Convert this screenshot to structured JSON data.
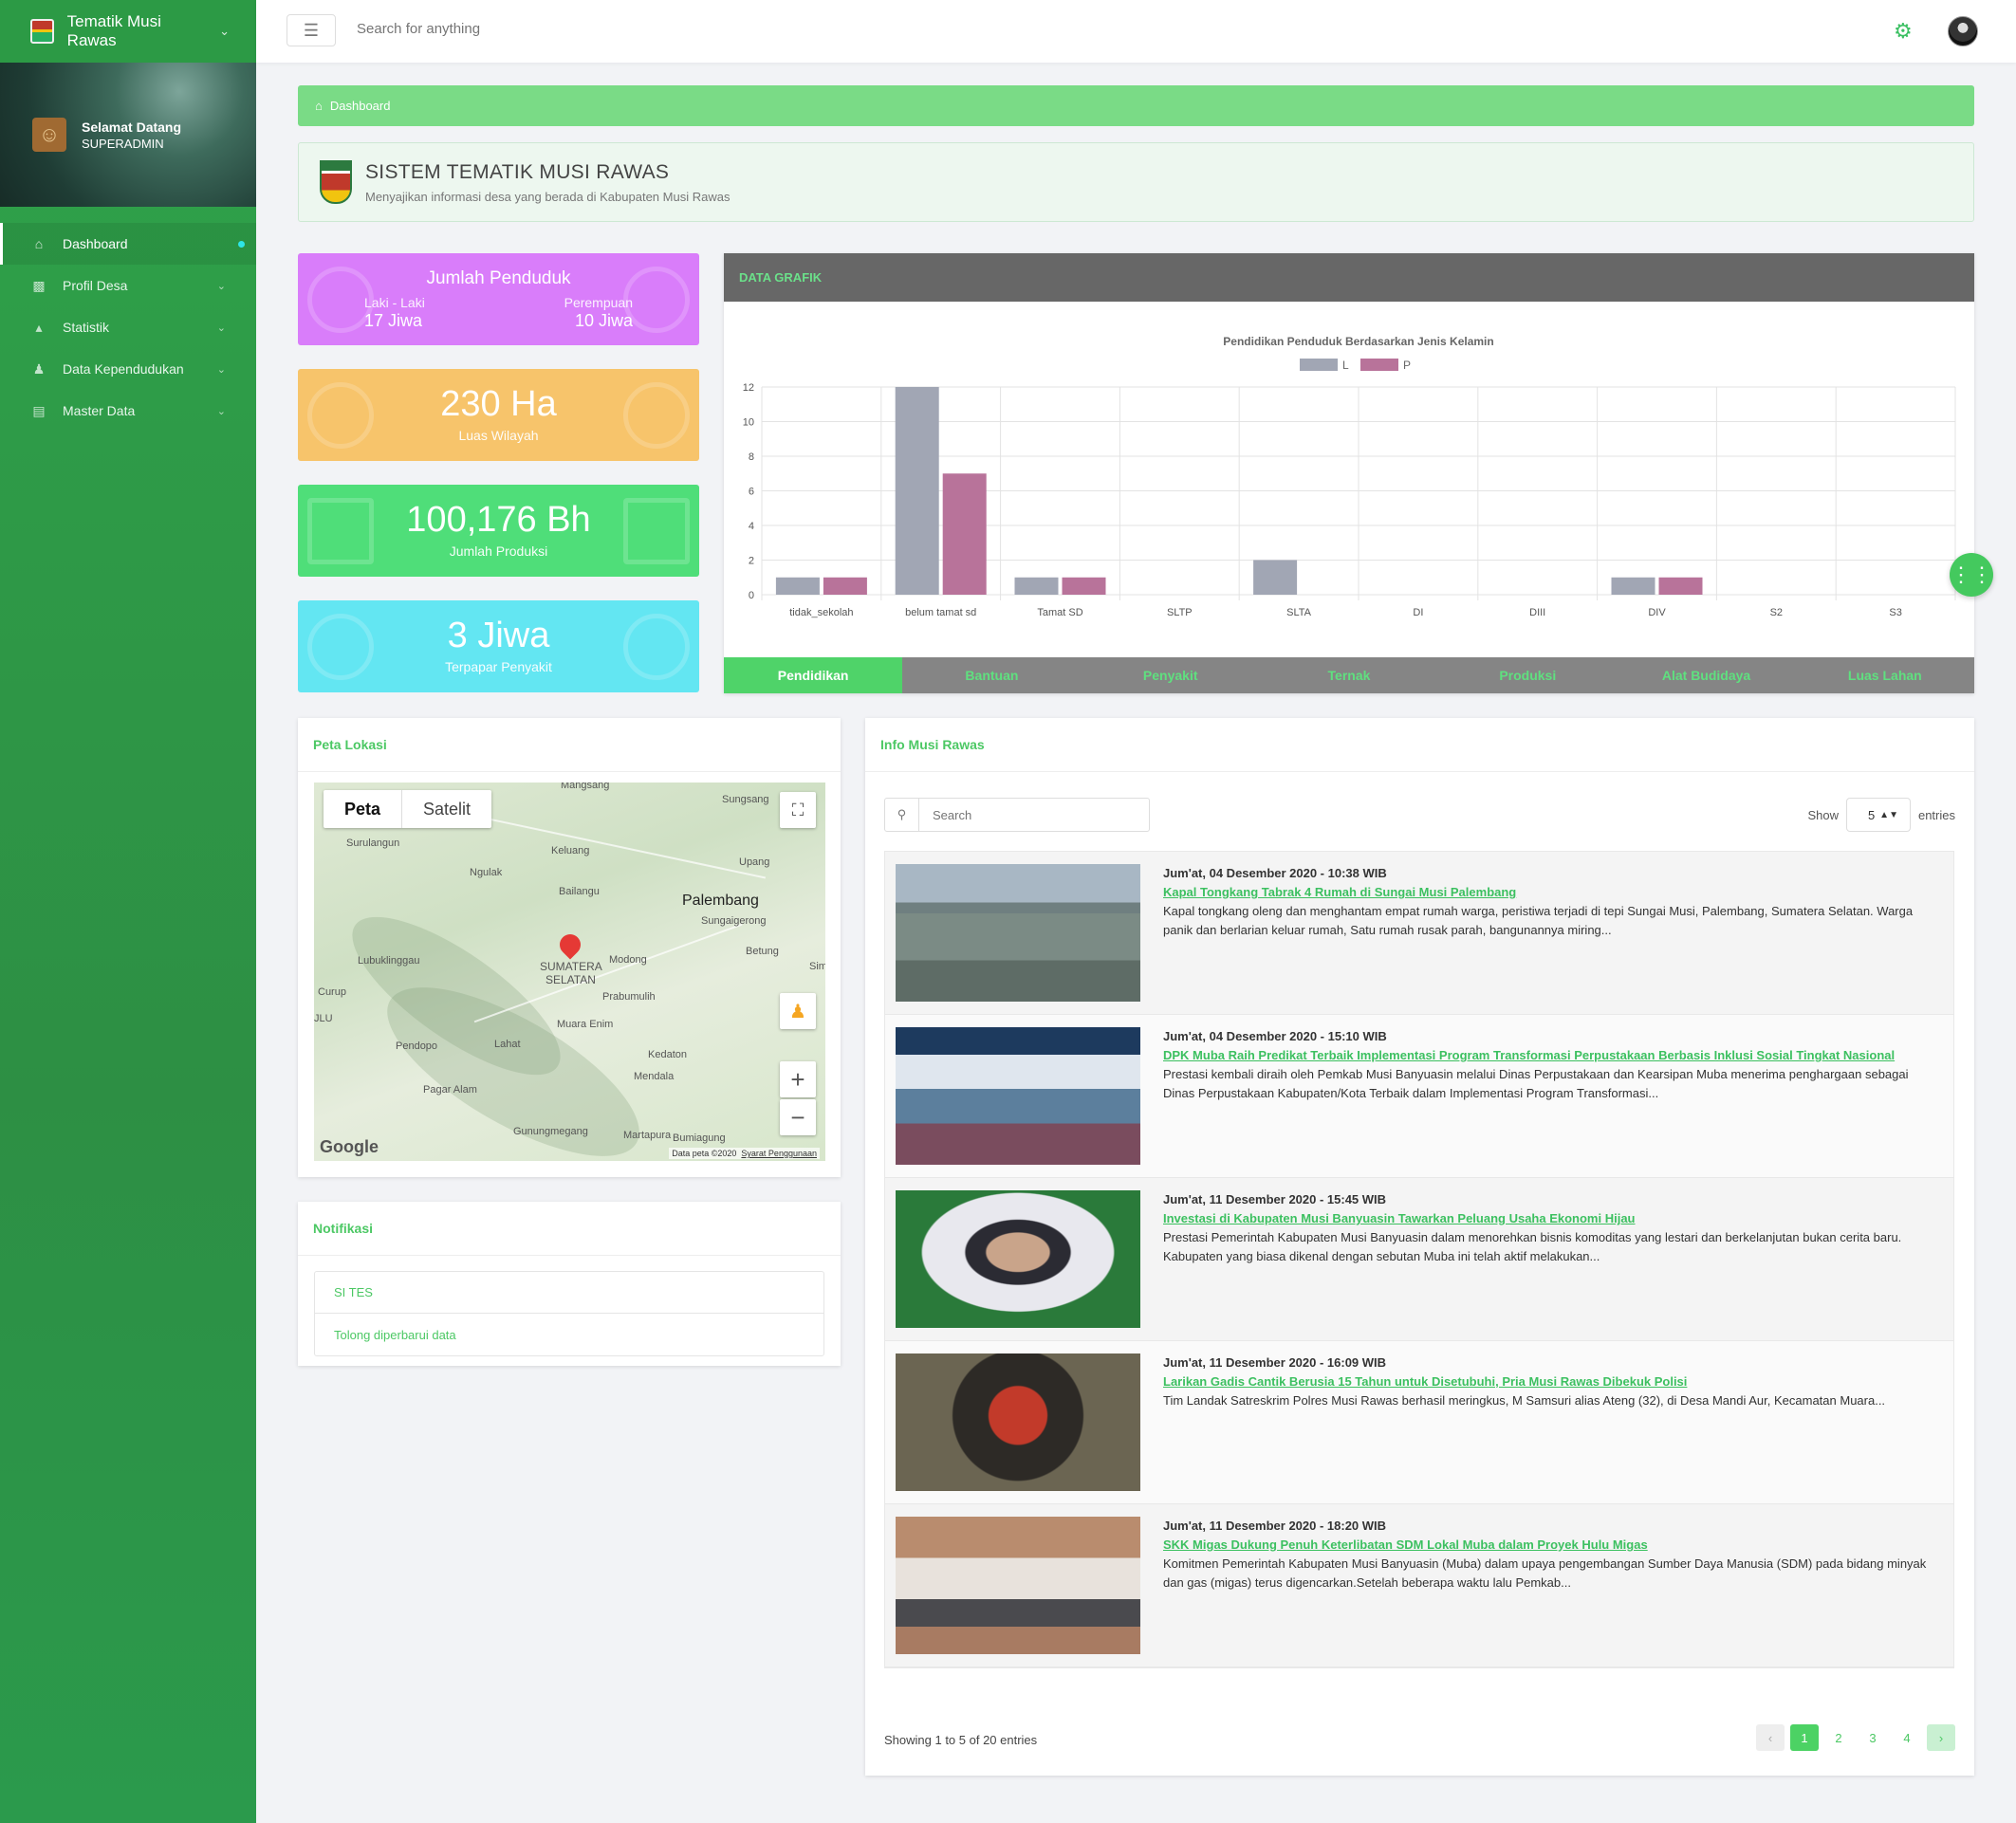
{
  "app": {
    "title": "Tematik Musi Rawas"
  },
  "user": {
    "greeting": "Selamat Datang",
    "role": "SUPERADMIN"
  },
  "sidebar": {
    "items": [
      {
        "label": "Dashboard",
        "icon": "home-icon"
      },
      {
        "label": "Profil Desa",
        "icon": "id-card-icon"
      },
      {
        "label": "Statistik",
        "icon": "area-chart-icon"
      },
      {
        "label": "Data Kependudukan",
        "icon": "users-icon"
      },
      {
        "label": "Master Data",
        "icon": "list-icon"
      }
    ]
  },
  "topbar": {
    "search_placeholder": "Search for anything"
  },
  "breadcrumb": {
    "label": "Dashboard"
  },
  "header": {
    "title": "SISTEM TEMATIK MUSI RAWAS",
    "subtitle": "Menyajikan informasi desa yang berada di Kabupaten Musi Rawas"
  },
  "stats": {
    "population": {
      "title": "Jumlah Penduduk",
      "male_label": "Laki - Laki",
      "male_value": "17 Jiwa",
      "female_label": "Perempuan",
      "female_value": "10 Jiwa"
    },
    "area": {
      "value": "230 Ha",
      "label": "Luas Wilayah"
    },
    "production": {
      "value": "100,176 Bh",
      "label": "Jumlah Produksi"
    },
    "disease": {
      "value": "3 Jiwa",
      "label": "Terpapar Penyakit"
    }
  },
  "chart_card": {
    "header": "DATA GRAFIK",
    "tabs": [
      "Pendidikan",
      "Bantuan",
      "Penyakit",
      "Ternak",
      "Produksi",
      "Alat Budidaya",
      "Luas Lahan"
    ],
    "active_tab": 0
  },
  "chart_data": {
    "type": "bar",
    "title": "Pendidikan Penduduk Berdasarkan Jenis Kelamin",
    "categories": [
      "tidak_sekolah",
      "belum tamat sd",
      "Tamat SD",
      "SLTP",
      "SLTA",
      "DI",
      "DIII",
      "DIV",
      "S2",
      "S3"
    ],
    "series": [
      {
        "name": "L",
        "color": "#a1a6b4",
        "values": [
          1,
          12,
          1,
          0,
          2,
          0,
          0,
          1,
          0,
          0
        ]
      },
      {
        "name": "P",
        "color": "#b8739a",
        "values": [
          1,
          7,
          1,
          0,
          0,
          0,
          0,
          1,
          0,
          0
        ]
      }
    ],
    "ylim": [
      0,
      12
    ],
    "yticks": [
      0,
      2,
      4,
      6,
      8,
      10,
      12
    ],
    "legend": "top-center",
    "grid": true
  },
  "map": {
    "title": "Peta Lokasi",
    "tabs": [
      "Peta",
      "Satelit"
    ],
    "places": [
      "Mangsang",
      "Sungsang",
      "Surulangun",
      "Keluang",
      "Ngulak",
      "Upang",
      "Bailangu",
      "Palembang",
      "Sungaigerong",
      "Betung",
      "Lubuklinggau",
      "Modong",
      "SUMATERA",
      "SELATAN",
      "Curup",
      "Prabumulih",
      "JLU",
      "Muara Enim",
      "Lahat",
      "Pendopo",
      "Kedaton",
      "Mendala",
      "Pagar Alam",
      "Gunungmegang",
      "Martapura",
      "Bumiagung",
      "Sim"
    ],
    "logo": "Google",
    "attribution": "Data peta ©2020",
    "terms": "Syarat Penggunaan"
  },
  "notifications": {
    "title": "Notifikasi",
    "items": [
      "SI TES",
      "Tolong diperbarui data"
    ]
  },
  "info": {
    "title": "Info Musi Rawas",
    "search_placeholder": "Search",
    "show_label": "Show",
    "entries_value": "5",
    "entries_label": "entries",
    "items": [
      {
        "date": "Jum'at, 04 Desember 2020 - 10:38 WIB",
        "title": "Kapal Tongkang Tabrak 4 Rumah di Sungai Musi Palembang",
        "excerpt": "Kapal tongkang oleng dan menghantam empat rumah warga, peristiwa terjadi di tepi Sungai Musi, Palembang, Sumatera Selatan. Warga panik dan berlarian keluar rumah, Satu rumah rusak parah, bangunannya miring..."
      },
      {
        "date": "Jum'at, 04 Desember 2020 - 15:10 WIB",
        "title": "DPK Muba Raih Predikat Terbaik Implementasi Program Transformasi Perpustakaan Berbasis Inklusi Sosial Tingkat Nasional",
        "excerpt": "Prestasi kembali diraih oleh Pemkab Musi Banyuasin melalui Dinas Perpustakaan dan Kearsipan Muba menerima penghargaan sebagai Dinas Perpustakaan Kabupaten/Kota Terbaik dalam Implementasi Program Transformasi..."
      },
      {
        "date": "Jum'at, 11 Desember 2020 - 15:45 WIB",
        "title": "Investasi di Kabupaten Musi Banyuasin Tawarkan Peluang Usaha Ekonomi Hijau",
        "excerpt": "Prestasi Pemerintah Kabupaten Musi Banyuasin dalam menorehkan bisnis komoditas yang lestari dan berkelanjutan bukan cerita baru. Kabupaten yang biasa dikenal dengan sebutan Muba ini telah aktif melakukan..."
      },
      {
        "date": "Jum'at, 11 Desember 2020 - 16:09 WIB",
        "title": "Larikan Gadis Cantik Berusia 15 Tahun untuk Disetubuhi, Pria Musi Rawas Dibekuk Polisi",
        "excerpt": "Tim Landak Satreskrim Polres Musi Rawas berhasil meringkus, M Samsuri alias Ateng (32), di Desa Mandi Aur, Kecamatan Muara..."
      },
      {
        "date": "Jum'at, 11 Desember 2020 - 18:20 WIB",
        "title": "SKK Migas Dukung Penuh Keterlibatan SDM Lokal Muba dalam Proyek Hulu Migas",
        "excerpt": "Komitmen Pemerintah Kabupaten Musi Banyuasin (Muba) dalam upaya pengembangan Sumber Daya Manusia (SDM) pada bidang minyak dan gas (migas) terus digencarkan.Setelah beberapa waktu lalu Pemkab..."
      }
    ],
    "footer": "Showing 1 to 5 of 20 entries",
    "pages": [
      "1",
      "2",
      "3",
      "4"
    ],
    "current_page": "1"
  },
  "colors": {
    "primary": "#3cc063",
    "sidebar": "#2d9a47",
    "chart_header": "#676767"
  }
}
